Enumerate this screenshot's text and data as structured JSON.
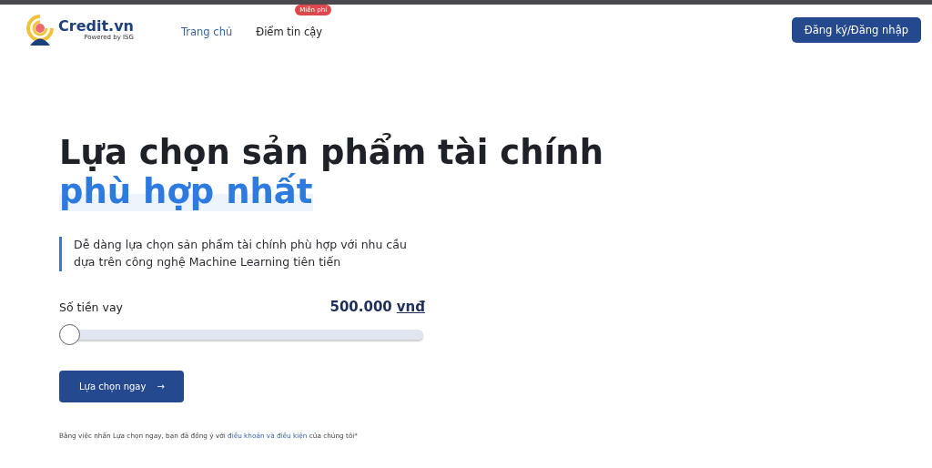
{
  "header": {
    "logo": {
      "name": "Credit.vn",
      "tagline": "Powered by ISG"
    },
    "nav": [
      {
        "label": "Trang chủ",
        "selected": true
      },
      {
        "label": "Điểm tin cậy",
        "selected": false,
        "badge": "Miễn phí"
      }
    ],
    "auth_button": "Đăng ký/Đăng nhập"
  },
  "hero": {
    "title": "Lựa chọn sản phẩm tài chính",
    "title_highlight": "phù hợp nhất",
    "description": "Dễ dàng lựa chọn sản phẩm tài chính phù hợp với nhu cầu dựa trên công nghệ Machine Learning tiên tiến",
    "loan": {
      "label": "Số tiền vay",
      "amount": "500.000",
      "unit": "vnđ",
      "level": 0
    },
    "cta": "Lựa chọn ngay",
    "arrow": "→",
    "terms": {
      "before": "Bằng việc nhấn Lựa chọn ngay, bạn đã đồng ý với",
      "link": "điều khoản và điều kiện",
      "after": "của chúng tôi*"
    }
  }
}
